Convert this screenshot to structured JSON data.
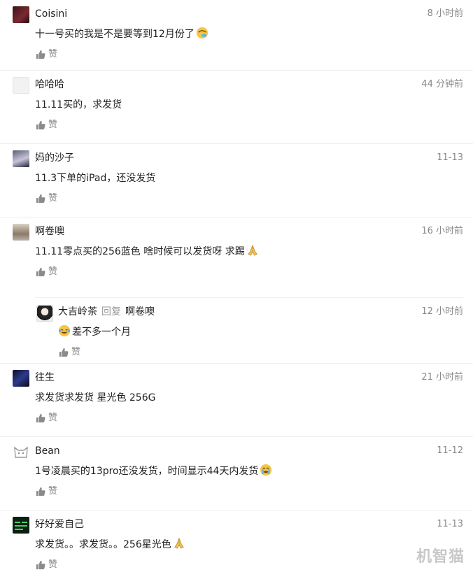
{
  "like_label": "赞",
  "reply_verb": "回复",
  "watermark": "机智猫",
  "comments": [
    {
      "user": "Coisini",
      "time": "8 小时前",
      "text": "十一号买的我是不是要等到12月份了",
      "emoji": "sad-cry-emoji"
    },
    {
      "user": "哈哈哈",
      "time": "44 分钟前",
      "text": "11.11买的，求发货"
    },
    {
      "user": "妈的沙子",
      "time": "11-13",
      "text": "11.3下单的iPad，还没发货"
    },
    {
      "user": "啊卷噢",
      "time": "16 小时前",
      "text": "11.11零点买的256蓝色 啥时候可以发货呀 求踢",
      "emoji": "pray-emoji",
      "reply": {
        "user": "大吉岭茶",
        "target": "啊卷噢",
        "time": "12 小时前",
        "text": "差不多一个月",
        "emoji": "laugh-cry-emoji"
      }
    },
    {
      "user": "往生",
      "time": "21 小时前",
      "text": "求发货求发货 星光色 256G"
    },
    {
      "user": "Bean",
      "time": "11-12",
      "text": "1号凌晨买的13pro还没发货，时间显示44天内发货",
      "emoji": "crying-emoji"
    },
    {
      "user": "好好爱自己",
      "time": "11-13",
      "text": "求发货。。求发货。。256星光色",
      "emoji": "pray-emoji"
    }
  ]
}
